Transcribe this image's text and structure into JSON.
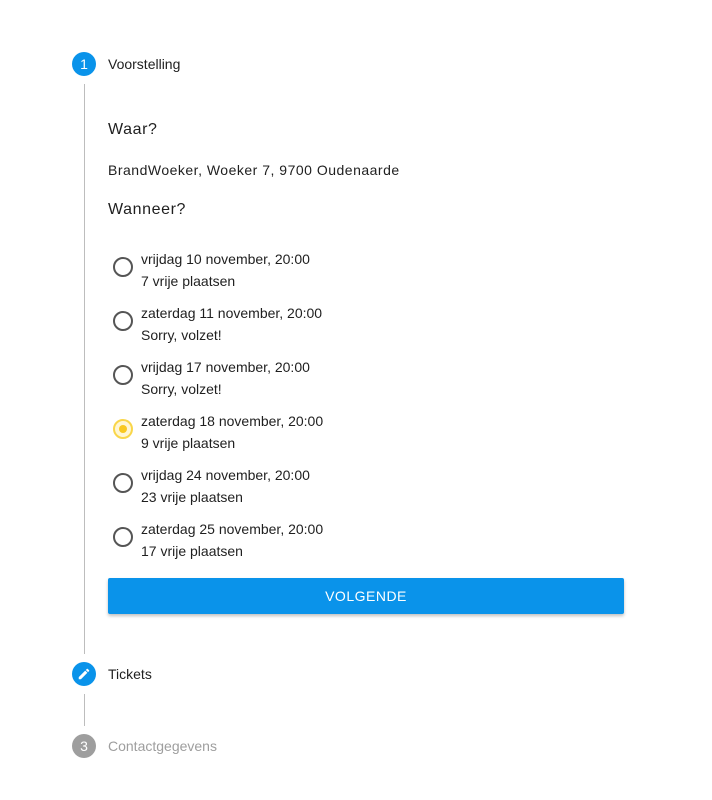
{
  "stepper": {
    "steps": [
      {
        "number": "1",
        "label": "Voorstelling",
        "state": "active"
      },
      {
        "number": "2",
        "label": "Tickets",
        "state": "edit",
        "icon": "pencil-icon"
      },
      {
        "number": "3",
        "label": "Contactgegevens",
        "state": "inactive"
      }
    ]
  },
  "voorstelling": {
    "where_heading": "Waar?",
    "address": "BrandWoeker, Woeker 7, 9700 Oudenaarde",
    "when_heading": "Wanneer?",
    "options": [
      {
        "date": "vrijdag 10 november, 20:00",
        "availability": "7 vrije plaatsen",
        "selected": false
      },
      {
        "date": "zaterdag 11 november, 20:00",
        "availability": "Sorry, volzet!",
        "selected": false
      },
      {
        "date": "vrijdag 17 november, 20:00",
        "availability": "Sorry, volzet!",
        "selected": false
      },
      {
        "date": "zaterdag 18 november, 20:00",
        "availability": "9 vrije plaatsen",
        "selected": true
      },
      {
        "date": "vrijdag 24 november, 20:00",
        "availability": "23 vrije plaatsen",
        "selected": false
      },
      {
        "date": "zaterdag 25 november, 20:00",
        "availability": "17 vrije plaatsen",
        "selected": false
      }
    ],
    "next_label": "VOLGENDE"
  },
  "colors": {
    "primary": "#0a93ea",
    "selected_radio": "#f9c81f",
    "inactive_step": "#9e9e9e"
  }
}
